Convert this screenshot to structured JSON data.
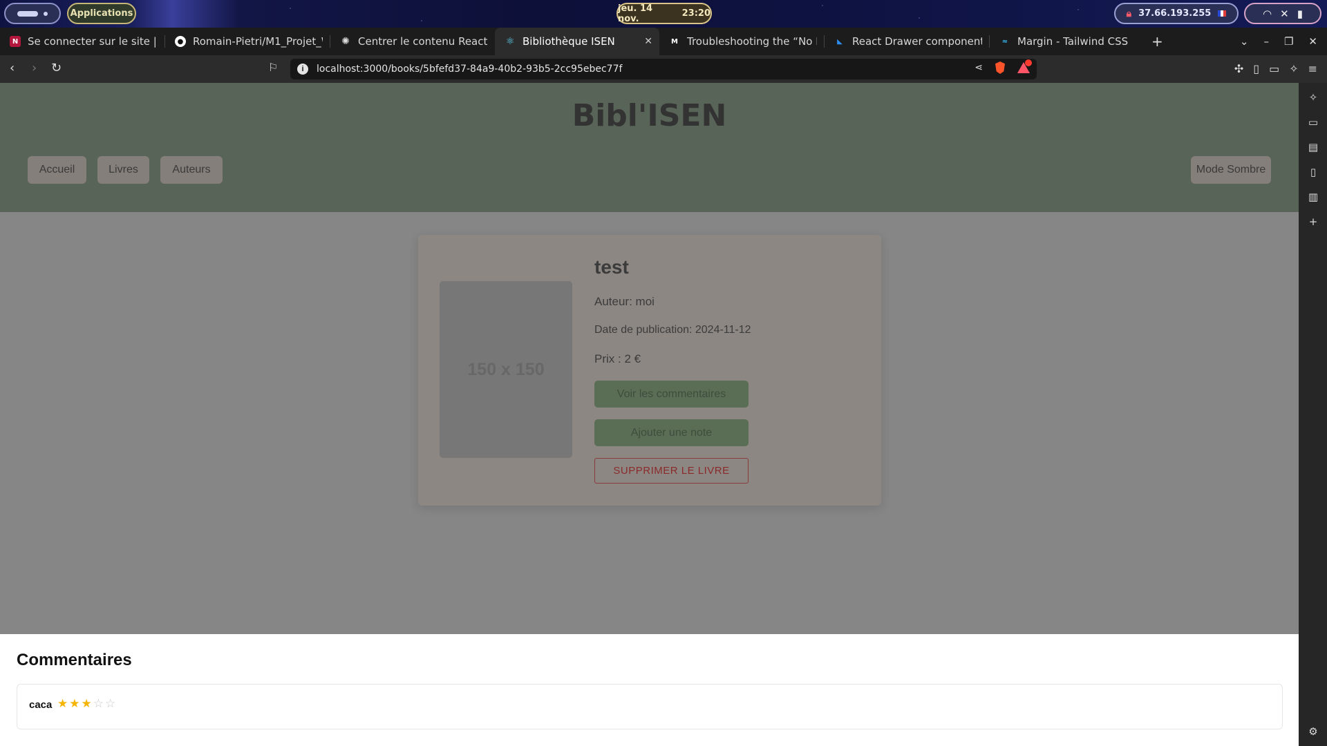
{
  "desktop": {
    "apps_label": "Applications",
    "clock_date": "jeu. 14 nov.",
    "clock_time": "23:20",
    "ip": "37.66.193.255"
  },
  "browser": {
    "tabs": [
      {
        "title": "Se connecter sur le site | JUN",
        "favicon": "junia-icon"
      },
      {
        "title": "Romain-Pietri/M1_Projet_W",
        "favicon": "github-icon"
      },
      {
        "title": "Centrer le contenu React",
        "favicon": "openai-icon"
      },
      {
        "title": "Bibliothèque ISEN",
        "favicon": "react-icon",
        "active": true
      },
      {
        "title": "Troubleshooting the “No Me",
        "favicon": "medium-icon"
      },
      {
        "title": "React Drawer component - M",
        "favicon": "mui-icon"
      },
      {
        "title": "Margin - Tailwind CSS",
        "favicon": "tailwind-icon"
      }
    ],
    "url": "localhost:3000/books/5bfefd37-84a9-40b2-93b5-2cc95ebec77f"
  },
  "site": {
    "title": "Bibl'ISEN",
    "nav": {
      "home": "Accueil",
      "books": "Livres",
      "authors": "Auteurs"
    },
    "dark_mode": "Mode Sombre"
  },
  "book": {
    "image_placeholder": "150 x 150",
    "title": "test",
    "author_label": "Auteur: moi",
    "date_label": "Date de publication: 2024-11-12",
    "price_label": "Prix : 2 €",
    "view_comments": "Voir les commentaires",
    "add_rating": "Ajouter une note",
    "delete": "SUPPRIMER LE LIVRE"
  },
  "comments": {
    "heading": "Commentaires",
    "items": [
      {
        "text": "caca",
        "rating": 3,
        "max": 5
      }
    ]
  },
  "colors": {
    "header_bg": "#586457",
    "overlay_bg": "#868686",
    "star": "#f5b400",
    "delete": "#8a2a2a"
  }
}
